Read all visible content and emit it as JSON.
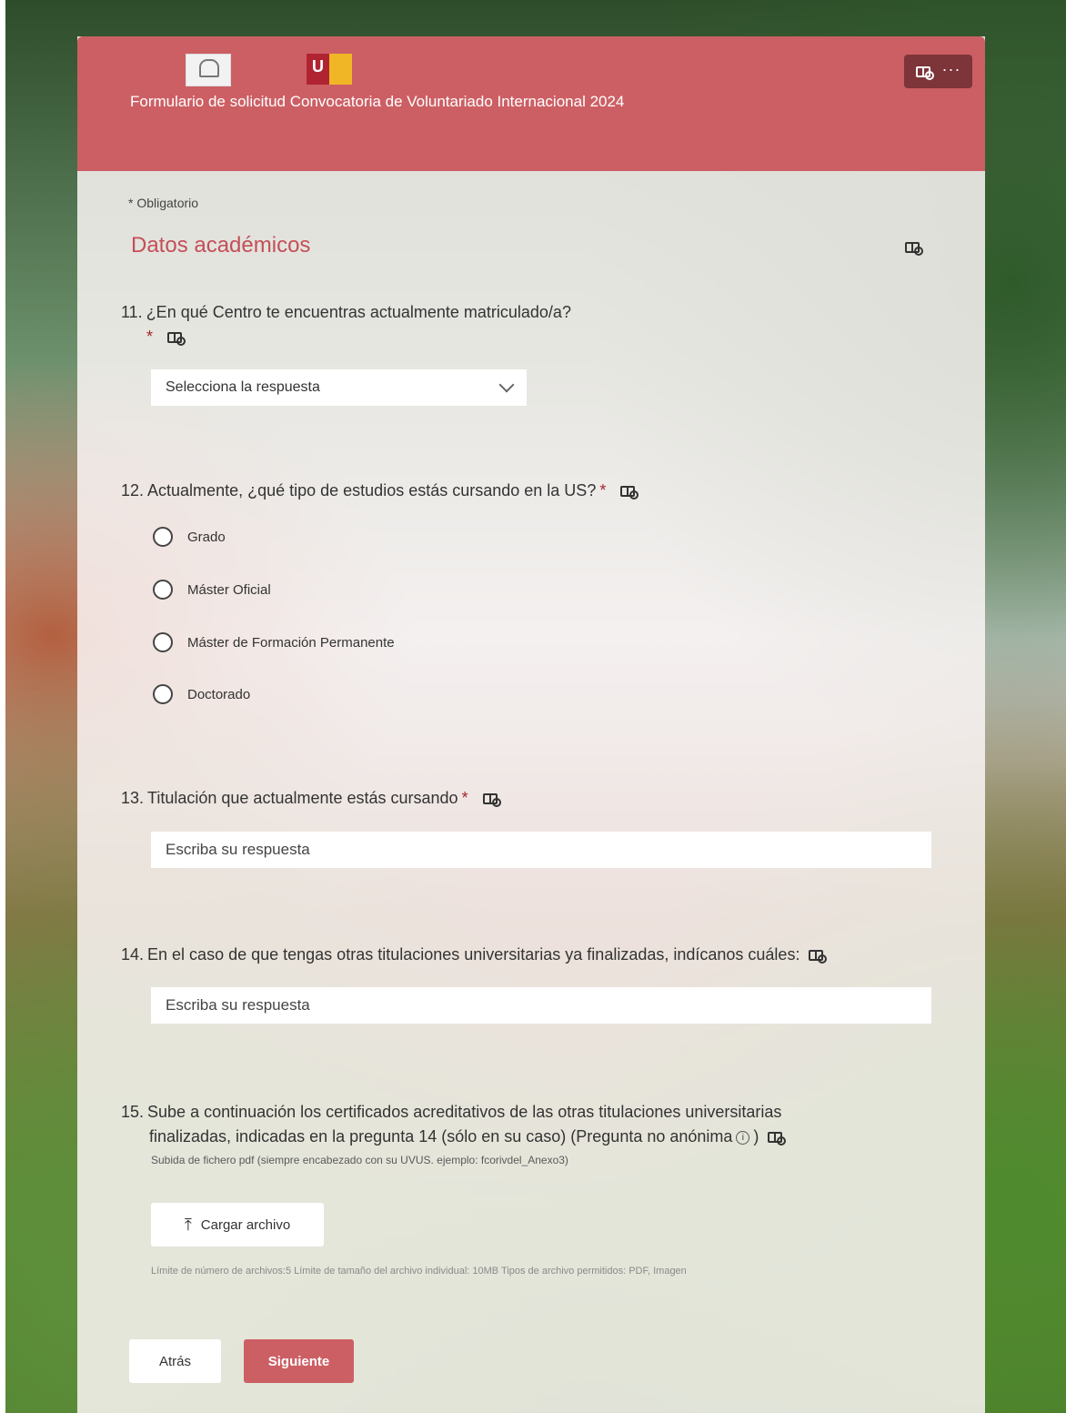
{
  "header": {
    "title": "Formulario de solicitud Convocatoria de Voluntariado Internacional 2024",
    "logo2_letter": "U"
  },
  "form": {
    "required_note": "* Obligatorio",
    "section_title": "Datos académicos",
    "q11": {
      "number": "11.",
      "text": "¿En qué Centro te encuentras actualmente matriculado/a?",
      "required": "*",
      "dropdown_value": "Selecciona la respuesta"
    },
    "q12": {
      "number": "12.",
      "text": "Actualmente, ¿qué tipo de estudios estás cursando en la US?",
      "required": "*",
      "options": [
        "Grado",
        "Máster Oficial",
        "Máster de Formación Permanente",
        "Doctorado"
      ]
    },
    "q13": {
      "number": "13.",
      "text": "Titulación que actualmente estás cursando",
      "required": "*",
      "placeholder": "Escriba su respuesta"
    },
    "q14": {
      "number": "14.",
      "text": "En el caso de que tengas otras titulaciones universitarias ya finalizadas, indícanos cuáles:",
      "placeholder": "Escriba su respuesta"
    },
    "q15": {
      "number": "15.",
      "text_line1": "Sube a continuación los certificados acreditativos de las otras titulaciones universitarias",
      "text_line2": "finalizadas, indicadas en la pregunta 14 (sólo en su caso) (Pregunta no anónima",
      "text_close": ")",
      "info_glyph": "i",
      "hint": "Subida de fichero pdf (siempre encabezado con su UVUS. ejemplo: fcorivdel_Anexo3)",
      "upload_label": "Cargar archivo",
      "limits": "Límite de número de archivos:5   Límite de tamaño del archivo individual: 10MB   Tipos de archivo permitidos: PDF, Imagen"
    }
  },
  "footer": {
    "back_label": "Atrás",
    "next_label": "Siguiente"
  },
  "icons": {
    "header_more": "more-options-icon",
    "reader": "immersive-reader-icon",
    "upload": "upload-icon",
    "dropdown": "chevron-down-icon"
  },
  "colors": {
    "brand": "#cc5f64",
    "required": "#a4262c",
    "section_title": "#c44f57"
  }
}
